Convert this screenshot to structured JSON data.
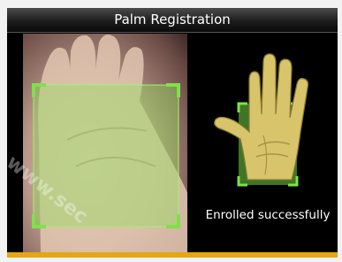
{
  "window": {
    "title": "Palm Registration"
  },
  "status": {
    "message": "Enrolled successfully",
    "state": "success"
  },
  "icons": {
    "hand_illustration": "palm-hand-icon",
    "camera_preview": "palm-camera-preview"
  },
  "watermark": {
    "text": "www.sec"
  },
  "colors": {
    "detect_box": "#8ee05a",
    "title_bar": "#1d1d1d",
    "accent_strip": "#e6a514",
    "hand_fill": "#d8c46a"
  }
}
